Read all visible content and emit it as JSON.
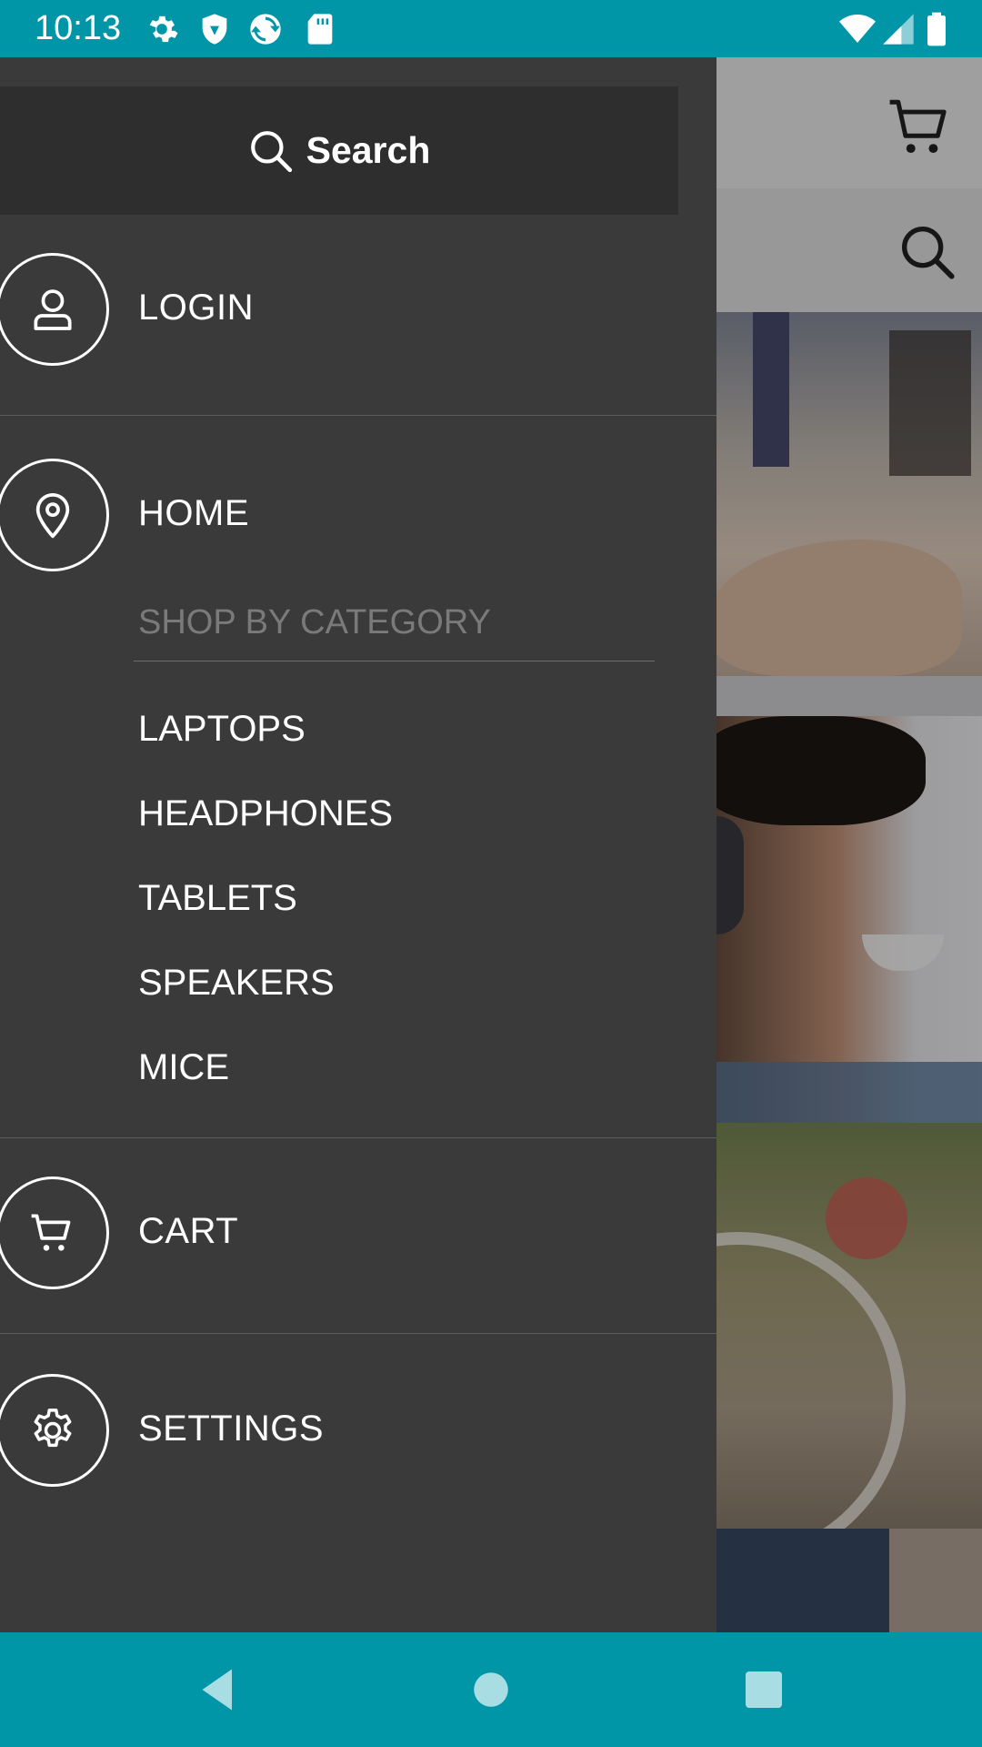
{
  "status_bar": {
    "time": "10:13",
    "left_icons": [
      "gear-icon",
      "shield-icon",
      "sync-icon",
      "sd-card-icon"
    ],
    "right_icons": [
      "wifi-icon",
      "signal-icon",
      "battery-icon"
    ]
  },
  "drawer": {
    "search": {
      "label": "Search",
      "icon": "search-icon"
    },
    "items": [
      {
        "label": "LOGIN",
        "icon": "user-icon"
      },
      {
        "label": "HOME",
        "icon": "location-pin-icon"
      },
      {
        "label": "CART",
        "icon": "cart-icon"
      },
      {
        "label": "SETTINGS",
        "icon": "gear-icon"
      }
    ],
    "category": {
      "heading": "SHOP BY CATEGORY",
      "items": [
        "LAPTOPS",
        "HEADPHONES",
        "TABLETS",
        "SPEAKERS",
        "MICE"
      ]
    }
  },
  "background": {
    "appbar_icons": [
      "cart-icon",
      "search-icon"
    ]
  },
  "nav_bar": {
    "buttons": [
      "back-button",
      "home-button",
      "recents-button"
    ]
  },
  "colors": {
    "status_bar": "#0096a8",
    "drawer_bg": "#3b3a3a",
    "drawer_search_bg": "#2f2e2e",
    "category_heading": "#7b7a7a"
  }
}
